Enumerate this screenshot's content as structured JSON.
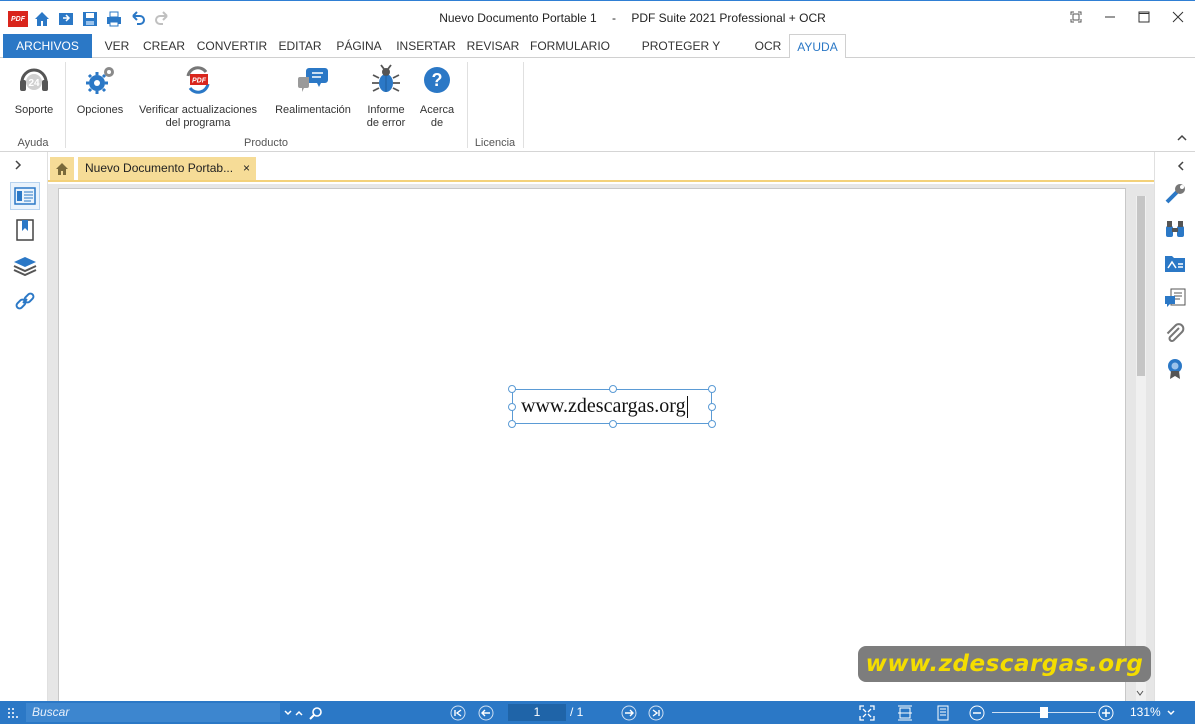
{
  "window": {
    "document_name": "Nuevo Documento Portable 1",
    "separator": "-",
    "app_name": "PDF Suite 2021  Professional + OCR"
  },
  "qat": {
    "logo_text": "PDF"
  },
  "menu": {
    "tabs": [
      "ARCHIVOS",
      "VER",
      "CREAR",
      "CONVERTIR",
      "EDITAR",
      "PÁGINA",
      "INSERTAR",
      "REVISAR",
      "FORMULARIO",
      "PROTEGER Y FIRMAR",
      "OCR",
      "AYUDA"
    ],
    "active": "AYUDA"
  },
  "ribbon": {
    "support_label": "Soporte",
    "support_badge": "24",
    "options_label": "Opciones",
    "check_updates_label_1": "Verificar actualizaciones",
    "check_updates_label_2": "del programa",
    "feedback_label": "Realimentación",
    "error_report_label_1": "Informe",
    "error_report_label_2": "de error",
    "about_label_1": "Acerca",
    "about_label_2": "de",
    "groups": {
      "help": "Ayuda",
      "product": "Producto",
      "license": "Licencia"
    }
  },
  "doc_tab": {
    "title": "Nuevo Documento Portab...",
    "close": "×"
  },
  "page": {
    "text": "www.zdescargas.org"
  },
  "watermark": "www.zdescargas.org",
  "status": {
    "search_placeholder": "Buscar",
    "current_page": "1",
    "total_pages": "/ 1",
    "zoom": "131%",
    "zoom_level": 0.5
  },
  "colors": {
    "accent": "#2b78c6",
    "tab_yellow": "#f6dc97",
    "watermark_text": "#f4dd00"
  }
}
